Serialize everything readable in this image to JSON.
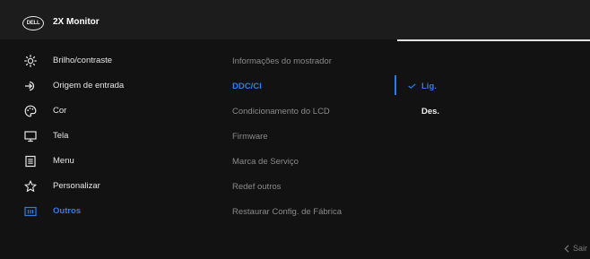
{
  "header": {
    "logo_text": "DELL",
    "title": "2X Monitor"
  },
  "menu": {
    "items": [
      {
        "label": "Brilho/contraste",
        "icon": "brightness-icon"
      },
      {
        "label": "Origem de entrada",
        "icon": "input-source-icon"
      },
      {
        "label": "Cor",
        "icon": "color-palette-icon"
      },
      {
        "label": "Tela",
        "icon": "display-icon"
      },
      {
        "label": "Menu",
        "icon": "menu-icon"
      },
      {
        "label": "Personalizar",
        "icon": "star-icon"
      },
      {
        "label": "Outros",
        "icon": "others-icon"
      }
    ],
    "active_index": 6
  },
  "submenu": {
    "items": [
      "Informações do mostrador",
      "DDC/CI",
      "Condicionamento do LCD",
      "Firmware",
      "Marca de Serviço",
      "Redef outros",
      "Restaurar Config. de Fábrica"
    ],
    "active_index": 1
  },
  "options": {
    "selected": "Lig.",
    "other": "Des."
  },
  "footer": {
    "exit_label": "Sair"
  },
  "colors": {
    "accent": "#2f7de3",
    "background": "#121212",
    "header": "#1c1c1c"
  }
}
